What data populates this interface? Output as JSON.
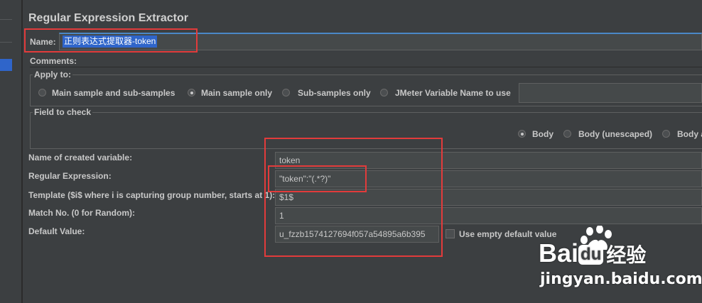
{
  "panel": {
    "title": "Regular Expression Extractor"
  },
  "name_field": {
    "label": "Name:",
    "value": "正则表达式提取器-token"
  },
  "comments": {
    "label": "Comments:"
  },
  "apply_to": {
    "legend": "Apply to:",
    "options": [
      "Main sample and sub-samples",
      "Main sample only",
      "Sub-samples only",
      "JMeter Variable Name to use"
    ],
    "selected": "Main sample only"
  },
  "field_to_check": {
    "legend": "Field to check",
    "options": [
      "Body",
      "Body (unescaped)",
      "Body a"
    ],
    "selected": "Body"
  },
  "form": {
    "variable_name": {
      "label": "Name of created variable:",
      "value": "token"
    },
    "regex": {
      "label": "Regular Expression:",
      "value": "\"token\":\"(.*?)\""
    },
    "template": {
      "label": "Template ($i$ where i is capturing group number, starts at 1):",
      "value": "$1$"
    },
    "match_no": {
      "label": "Match No. (0 for Random):",
      "value": "1"
    },
    "default_value": {
      "label": "Default Value:",
      "value": "u_fzzb1574127694f057a54895a6b395"
    },
    "use_empty_default": {
      "label": "Use empty default value",
      "checked": false
    }
  },
  "watermark": {
    "brand_left": "Bai",
    "brand_mid": "du",
    "brand_right": "经验",
    "url": "jingyan.baidu.com"
  },
  "colors": {
    "background": "#3c3f41",
    "field": "#45494a",
    "selection": "#2f65ca",
    "highlight_box": "#e23b3b"
  }
}
